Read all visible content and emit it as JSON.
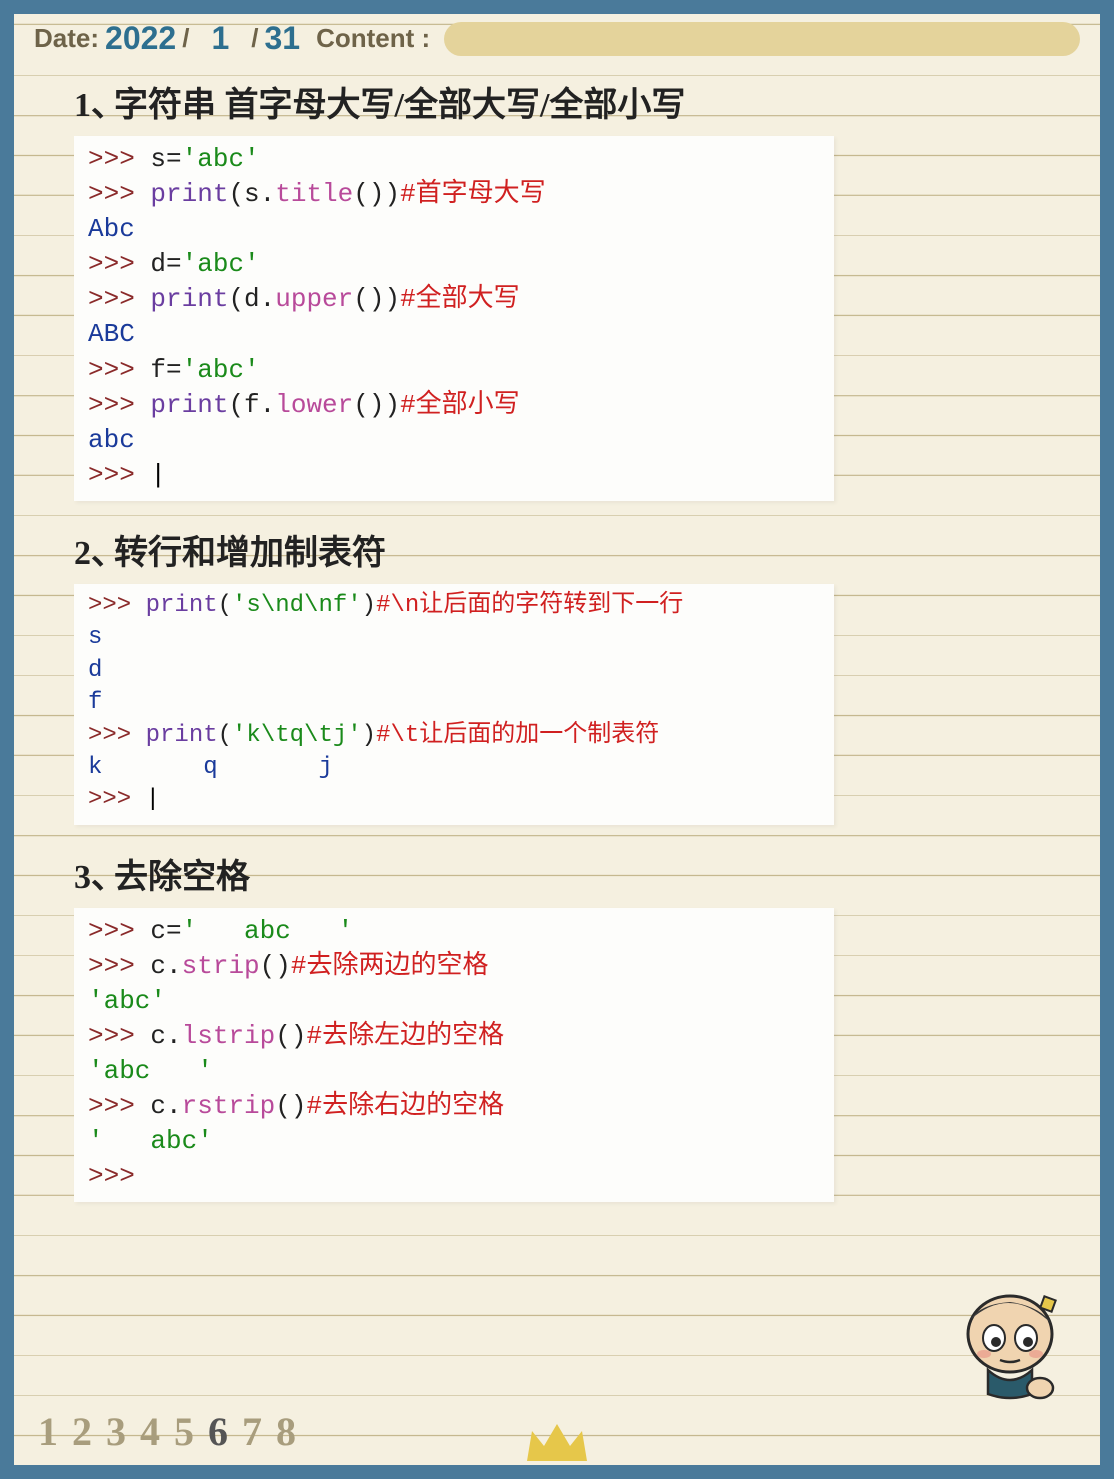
{
  "header": {
    "date_label": "Date:",
    "year": "2022",
    "sep": "/",
    "month": "1",
    "day": "31",
    "content_label": "Content :"
  },
  "section1": {
    "num": "1、",
    "title": "字符串 首字母大写/全部大写/全部小写",
    "lines": [
      [
        [
          "p-prompt",
          ">>> "
        ],
        [
          "p-plain",
          "s="
        ],
        [
          "p-str",
          "'abc'"
        ]
      ],
      [
        [
          "p-prompt",
          ">>> "
        ],
        [
          "p-kw",
          "print"
        ],
        [
          "p-plain",
          "(s."
        ],
        [
          "p-fn",
          "title"
        ],
        [
          "p-plain",
          "())"
        ],
        [
          "p-cmt",
          "#首字母大写"
        ]
      ],
      [
        [
          "p-out",
          "Abc"
        ]
      ],
      [
        [
          "p-prompt",
          ">>> "
        ],
        [
          "p-plain",
          "d="
        ],
        [
          "p-str",
          "'abc'"
        ]
      ],
      [
        [
          "p-prompt",
          ">>> "
        ],
        [
          "p-kw",
          "print"
        ],
        [
          "p-plain",
          "(d."
        ],
        [
          "p-fn",
          "upper"
        ],
        [
          "p-plain",
          "())"
        ],
        [
          "p-cmt",
          "#全部大写"
        ]
      ],
      [
        [
          "p-out",
          "ABC"
        ]
      ],
      [
        [
          "p-prompt",
          ">>> "
        ],
        [
          "p-plain",
          "f="
        ],
        [
          "p-str",
          "'abc'"
        ]
      ],
      [
        [
          "p-prompt",
          ">>> "
        ],
        [
          "p-kw",
          "print"
        ],
        [
          "p-plain",
          "(f."
        ],
        [
          "p-fn",
          "lower"
        ],
        [
          "p-plain",
          "())"
        ],
        [
          "p-cmt",
          "#全部小写"
        ]
      ],
      [
        [
          "p-out",
          "abc"
        ]
      ],
      [
        [
          "p-prompt",
          ">>> "
        ],
        [
          "cursor",
          "|"
        ]
      ]
    ]
  },
  "section2": {
    "num": "2、",
    "title": "转行和增加制表符",
    "lines": [
      [
        [
          "p-prompt",
          ">>> "
        ],
        [
          "p-kw",
          "print"
        ],
        [
          "p-plain",
          "("
        ],
        [
          "p-str",
          "'s\\nd\\nf'"
        ],
        [
          "p-plain",
          ")"
        ],
        [
          "p-cmt",
          "#\\n让后面的字符转到下一行"
        ]
      ],
      [
        [
          "p-out",
          "s"
        ]
      ],
      [
        [
          "p-out",
          "d"
        ]
      ],
      [
        [
          "p-out",
          "f"
        ]
      ],
      [
        [
          "p-prompt",
          ">>> "
        ],
        [
          "p-kw",
          "print"
        ],
        [
          "p-plain",
          "("
        ],
        [
          "p-str",
          "'k\\tq\\tj'"
        ],
        [
          "p-plain",
          ")"
        ],
        [
          "p-cmt",
          "#\\t让后面的加一个制表符"
        ]
      ],
      [
        [
          "p-out",
          "k       q       j"
        ]
      ],
      [
        [
          "p-prompt",
          ">>> "
        ],
        [
          "cursor",
          "|"
        ]
      ]
    ]
  },
  "section3": {
    "num": "3、",
    "title": "去除空格",
    "lines": [
      [
        [
          "p-prompt",
          ">>> "
        ],
        [
          "p-plain",
          "c="
        ],
        [
          "p-str",
          "'   abc   '"
        ]
      ],
      [
        [
          "p-prompt",
          ">>> "
        ],
        [
          "p-plain",
          "c."
        ],
        [
          "p-fn",
          "strip"
        ],
        [
          "p-plain",
          "()"
        ],
        [
          "p-cmt",
          "#去除两边的空格"
        ]
      ],
      [
        [
          "p-str",
          "'abc'"
        ]
      ],
      [
        [
          "p-prompt",
          ">>> "
        ],
        [
          "p-plain",
          "c."
        ],
        [
          "p-fn",
          "lstrip"
        ],
        [
          "p-plain",
          "()"
        ],
        [
          "p-cmt",
          "#去除左边的空格"
        ]
      ],
      [
        [
          "p-str",
          "'abc   '"
        ]
      ],
      [
        [
          "p-prompt",
          ">>> "
        ],
        [
          "p-plain",
          "c."
        ],
        [
          "p-fn",
          "rstrip"
        ],
        [
          "p-plain",
          "()"
        ],
        [
          "p-cmt",
          "#去除右边的空格"
        ]
      ],
      [
        [
          "p-str",
          "'   abc'"
        ]
      ],
      [
        [
          "p-prompt",
          ">>> "
        ]
      ]
    ]
  },
  "pager": {
    "pages": [
      "1",
      "2",
      "3",
      "4",
      "5",
      "6",
      "7",
      "8"
    ],
    "active": "6"
  }
}
